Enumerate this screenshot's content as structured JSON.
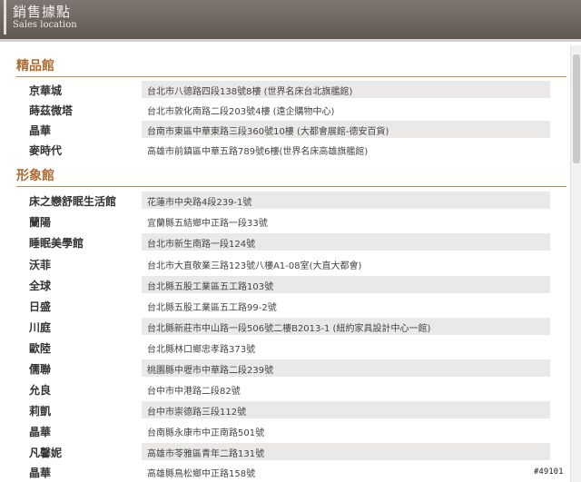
{
  "header": {
    "title_zh": "銷售據點",
    "title_en": "Sales location"
  },
  "sections": [
    {
      "title": "精品館",
      "rows": [
        {
          "name": "京華城",
          "address": "台北市八德路四段138號8樓 (世界名床台北旗艦館)"
        },
        {
          "name": "蒔茲微塔",
          "address": "台北市敦化南路二段203號4樓 (遠企購物中心)"
        },
        {
          "name": "晶華",
          "address": "台南市東區中華東路三段360號10樓 (大都會展館-德安百貨)"
        },
        {
          "name": "麥時代",
          "address": "高雄市前鎮區中華五路789號6樓(世界名床高雄旗艦館)"
        }
      ]
    },
    {
      "title": "形象館",
      "rows": [
        {
          "name": "床之戀舒眠生活館",
          "address": "花蓮市中央路4段239-1號"
        },
        {
          "name": "蘭陽",
          "address": "宜蘭縣五結鄉中正路一段33號"
        },
        {
          "name": "睡眠美學館",
          "address": "台北市新生南路一段124號"
        },
        {
          "name": "沃菲",
          "address": "台北市大直敬業三路123號八樓A1-08室(大直大都會)"
        },
        {
          "name": "全球",
          "address": "台北縣五股工業區五工路103號"
        },
        {
          "name": "日盛",
          "address": "台北縣五股工業區五工路99-2號"
        },
        {
          "name": "川庭",
          "address": "台北縣新莊市中山路一段506號二樓B2013-1 (紐約家具設計中心一館)"
        },
        {
          "name": "歐陸",
          "address": "台北縣林口鄉忠孝路373號"
        },
        {
          "name": "儒聯",
          "address": "桃園縣中壢市中華路二段239號"
        },
        {
          "name": "允良",
          "address": "台中市中港路二段82號"
        },
        {
          "name": "莉凱",
          "address": "台中市崇德路三段112號"
        },
        {
          "name": "晶華",
          "address": "台南縣永康市中正南路501號"
        },
        {
          "name": "凡馨妮",
          "address": "高雄市苓雅區青年二路131號"
        },
        {
          "name": "晶華",
          "address": "高雄縣鳥松鄉中正路158號"
        }
      ]
    }
  ],
  "watermark": "#49101"
}
